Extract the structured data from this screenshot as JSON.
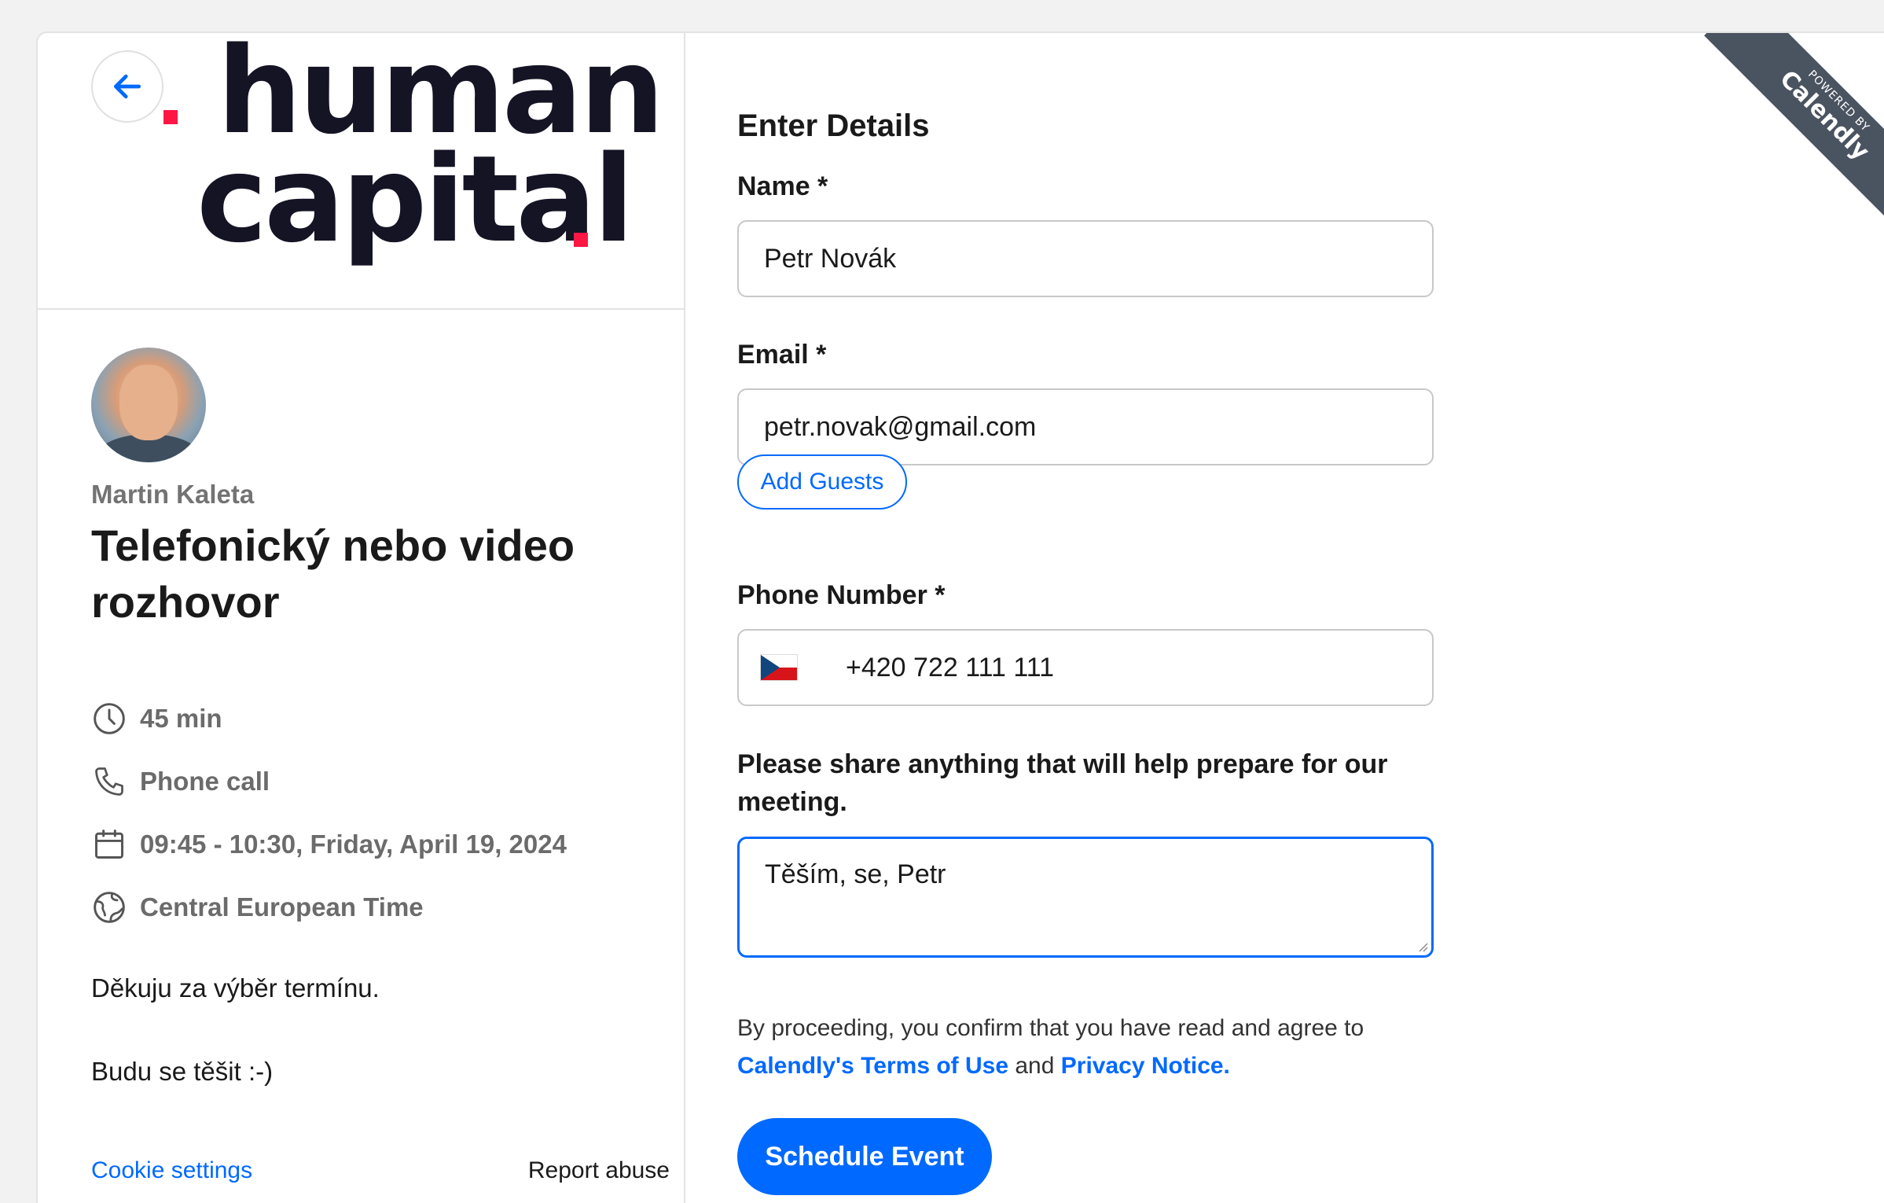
{
  "logo": {
    "line1": "human",
    "line2": "capital",
    "accent_color": "#ff1744",
    "text_color": "#141424"
  },
  "host": {
    "name": "Martin Kaleta"
  },
  "event": {
    "title": "Telefonický nebo video rozhovor",
    "duration": "45 min",
    "location": "Phone call",
    "datetime": "09:45 - 10:30, Friday, April 19, 2024",
    "timezone": "Central European Time",
    "description": [
      "Děkuju za výběr termínu.",
      "Budu se těšit :-)"
    ]
  },
  "footer": {
    "cookie_settings": "Cookie settings",
    "report_abuse": "Report abuse"
  },
  "form": {
    "heading": "Enter Details",
    "name_label": "Name *",
    "name_value": "Petr Novák",
    "email_label": "Email *",
    "email_value": "petr.novak@gmail.com",
    "add_guests": "Add Guests",
    "phone_label": "Phone Number *",
    "phone_value": "+420 722 111 111",
    "notes_label": "Please share anything that will help prepare for our meeting.",
    "notes_value": "Těším, se, Petr",
    "terms_prefix": "By proceeding, you confirm that you have read and agree to",
    "terms_link": "Calendly's Terms of Use",
    "terms_and": "and",
    "privacy_link": "Privacy Notice.",
    "submit": "Schedule Event"
  },
  "badge": {
    "small": "POWERED BY",
    "big": "Calendly"
  },
  "colors": {
    "primary": "#0069ff",
    "muted": "#737373"
  },
  "icons": {
    "back": "arrow-left-icon",
    "duration": "clock-icon",
    "location": "phone-icon",
    "date": "calendar-icon",
    "timezone": "globe-icon",
    "flag": "czech-flag-icon"
  }
}
